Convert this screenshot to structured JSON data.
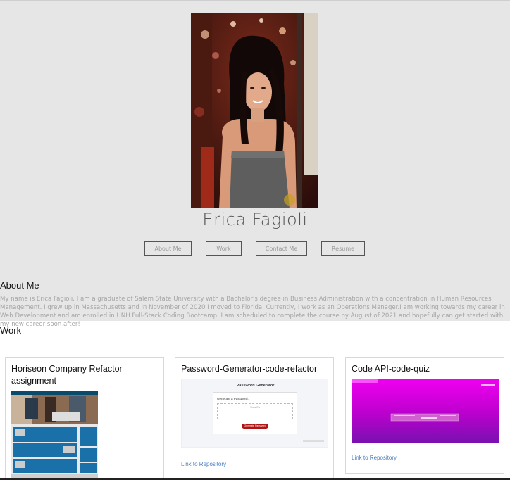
{
  "profile": {
    "name": "Erica Fagioli",
    "photo": "profile-photo"
  },
  "nav": {
    "items": [
      {
        "label": "About Me"
      },
      {
        "label": "Work"
      },
      {
        "label": "Contact Me"
      },
      {
        "label": "Resume"
      }
    ]
  },
  "about": {
    "title": "About Me",
    "text": "My name is Erica Fagioli. I am a graduate of Salem State University with a Bachelor's degree in Business Administration with a concentration in Human Resources Management. I grew up in Massachusetts and in November of 2020 I moved to Florida. Currently, I work as an Operations Manager.I am working towards my career in Web Development and am enrolled in UNH Full-Stack Coding Bootcamp. I am scheduled to complete the course by August of 2021 and hopefully can get started with my new career soon after!"
  },
  "work": {
    "title": "Work",
    "projects": [
      {
        "title": "Horiseon Company Refactor assignment",
        "link": "",
        "thumbnail": "horiseon-screenshot"
      },
      {
        "title": "Password-Generator-code-refactor",
        "link": "Link to Repository",
        "thumbnail": "password-generator-screenshot",
        "preview": {
          "heading": "Password Generator",
          "label": "Generate a Password:",
          "placeholder": "Your Se",
          "button": "Generate Password"
        }
      },
      {
        "title": "Code API-code-quiz",
        "link": "Link to Repository",
        "thumbnail": "code-quiz-screenshot"
      }
    ]
  },
  "colors": {
    "header_bg": "#e6e6e6",
    "link": "#4a7fc0",
    "quiz_magenta": "#e000e0",
    "generate_button": "#b01515"
  }
}
